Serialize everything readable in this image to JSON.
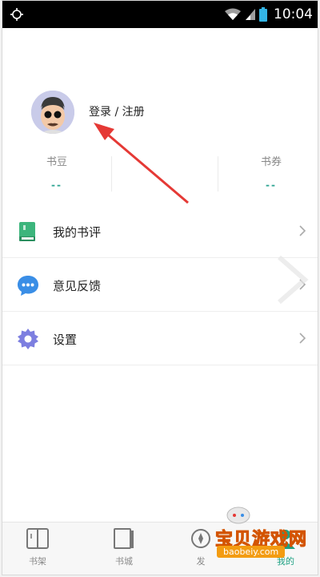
{
  "status_bar": {
    "time": "10:04"
  },
  "profile": {
    "login_label": "登录 / 注册"
  },
  "stats": [
    {
      "label": "书豆",
      "value": "--"
    },
    {
      "label": "书券",
      "value": "--"
    }
  ],
  "menu": [
    {
      "label": "我的书评",
      "icon": "book-review-icon",
      "color": "#3cb57c"
    },
    {
      "label": "意见反馈",
      "icon": "chat-bubble-icon",
      "color": "#3a8ee6"
    },
    {
      "label": "设置",
      "icon": "gear-icon",
      "color": "#7d7fe0"
    }
  ],
  "bottom_nav": [
    {
      "label": "书架",
      "icon": "bookshelf-icon"
    },
    {
      "label": "书城",
      "icon": "bookstore-icon"
    },
    {
      "label": "发",
      "icon": "discover-icon"
    },
    {
      "label": "我的",
      "icon": "profile-icon",
      "active": true
    }
  ],
  "watermark": {
    "site_name": "宝贝游戏网",
    "domain": "baobeiy.com"
  },
  "colors": {
    "accent": "#1ea183",
    "annotation_arrow": "#e53935"
  }
}
